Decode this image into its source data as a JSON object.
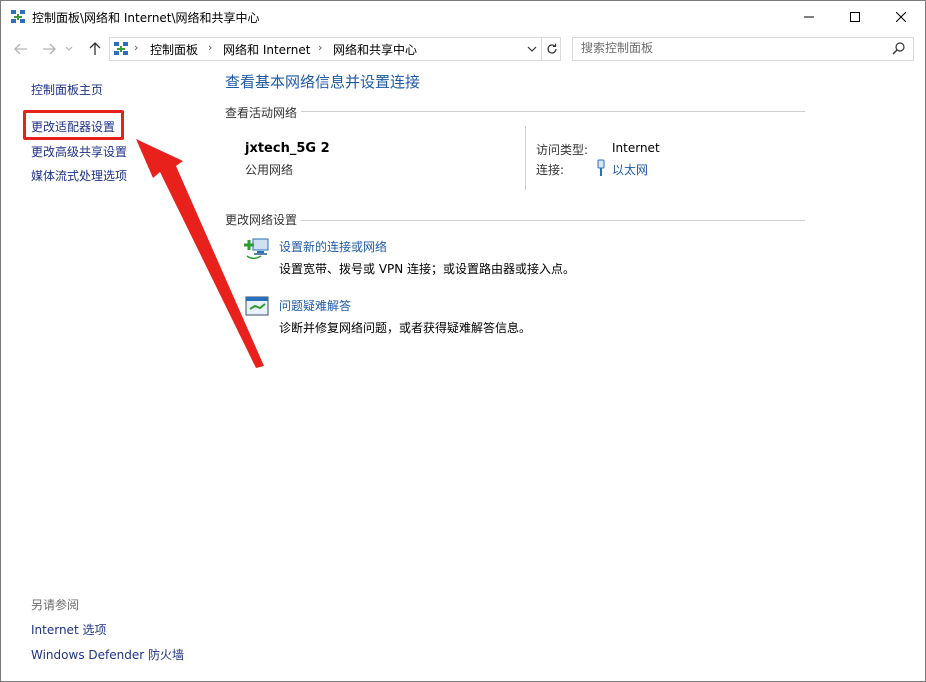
{
  "window": {
    "title": "控制面板\\网络和 Internet\\网络和共享中心"
  },
  "address_bar": {
    "crumbs": [
      "控制面板",
      "网络和 Internet",
      "网络和共享中心"
    ]
  },
  "search": {
    "placeholder": "搜索控制面板"
  },
  "left_pane": {
    "home": "控制面板主页",
    "links": [
      "更改适配器设置",
      "更改高级共享设置",
      "媒体流式处理选项"
    ],
    "see_also_title": "另请参阅",
    "see_also": [
      "Internet 选项",
      "Windows Defender 防火墙"
    ]
  },
  "main": {
    "heading": "查看基本网络信息并设置连接",
    "active_networks_label": "查看活动网络",
    "network": {
      "name": "jxtech_5G 2",
      "profile": "公用网络",
      "access_type_label": "访问类型:",
      "access_type_value": "Internet",
      "connections_label": "连接:",
      "connections_value": "以太网"
    },
    "change_settings_label": "更改网络设置",
    "tasks": [
      {
        "title": "设置新的连接或网络",
        "desc": "设置宽带、拨号或 VPN 连接；或设置路由器或接入点。"
      },
      {
        "title": "问题疑难解答",
        "desc": "诊断并修复网络问题，或者获得疑难解答信息。"
      }
    ]
  },
  "annotation": {
    "highlight_color": "#e8211c"
  },
  "colors": {
    "link": "#1e3287",
    "accent": "#1e5aa8"
  }
}
